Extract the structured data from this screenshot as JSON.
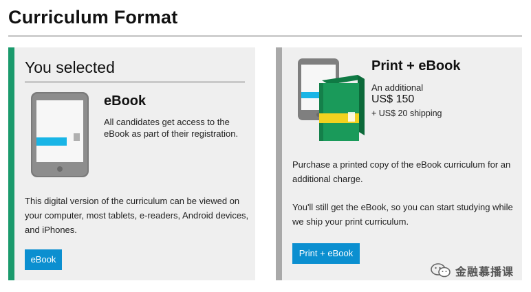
{
  "page": {
    "title": "Curriculum Format"
  },
  "selected_card": {
    "heading": "You selected",
    "name": "eBook",
    "description": "All candidates get access to the eBook as part of their registration.",
    "long_description": "This digital version of the curriculum can be viewed on your computer, most tablets, e-readers, Android devices, and iPhones.",
    "button_label": "eBook",
    "accent_color": "#1a9a6c"
  },
  "option_card": {
    "name": "Print + eBook",
    "additional_label": "An additional",
    "price": "US$ 150",
    "shipping": "+ US$ 20 shipping",
    "description_1": "Purchase a printed copy of the eBook curriculum for an additional charge.",
    "description_2": "You'll still get the eBook, so you can start studying while we ship your print curriculum.",
    "button_label": "Print + eBook",
    "accent_color": "#a9a9a9"
  },
  "icons": {
    "tablet": "tablet-icon",
    "book": "book-icon",
    "watermark": "wechat-icon"
  },
  "colors": {
    "button": "#0b8fd0",
    "book_green": "#1a9a5a",
    "book_yellow": "#f2d21f",
    "tablet_cyan": "#19b5e6"
  },
  "watermark": {
    "text": "金融慕播课"
  }
}
